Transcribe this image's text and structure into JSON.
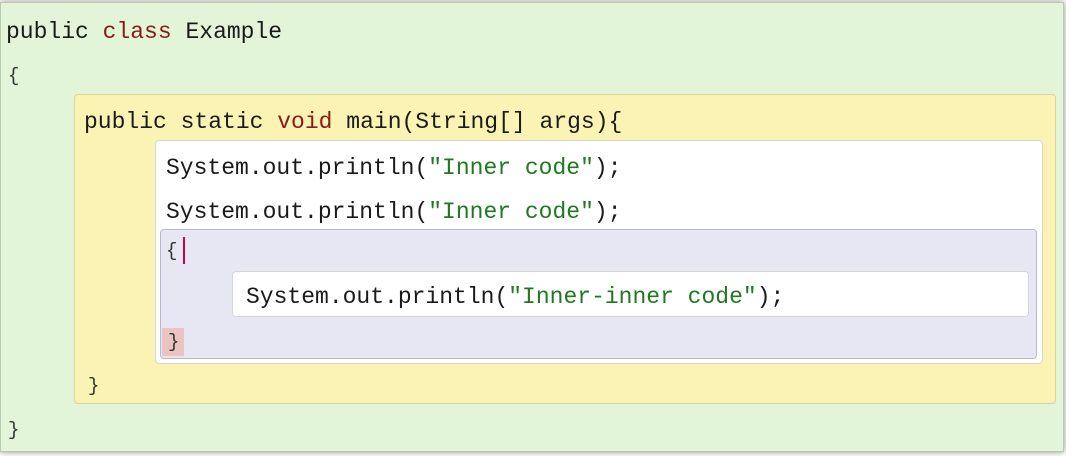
{
  "code": {
    "line1": {
      "kw1": "public",
      "kw2": "class",
      "name": "Example"
    },
    "line2": {
      "open_brace": "{"
    },
    "line3": {
      "modifiers": "public static",
      "return_type": "void",
      "signature": "main(String[] args){"
    },
    "line4": {
      "call": "System.out.println(",
      "string": "\"Inner code\"",
      "end": ");"
    },
    "line5": {
      "call": "System.out.println(",
      "string": "\"Inner code\"",
      "end": ");"
    },
    "line6": {
      "open_brace": "{"
    },
    "line7": {
      "call": "System.out.println(",
      "string": "\"Inner-inner code\"",
      "end": ");"
    },
    "line8": {
      "close_brace": "}"
    },
    "line9": {
      "close_brace": "}"
    },
    "line10": {
      "close_brace": "}"
    }
  },
  "colors": {
    "keyword": "#8b1a1a",
    "string": "#1f7a1f",
    "class_scope": "#e2f5d9",
    "method_scope": "#fbf3b4",
    "body_scope": "#ffffff",
    "inner_scope": "#e7e7f3",
    "matched_brace": "#eac3c3",
    "caret": "#cc0044"
  }
}
